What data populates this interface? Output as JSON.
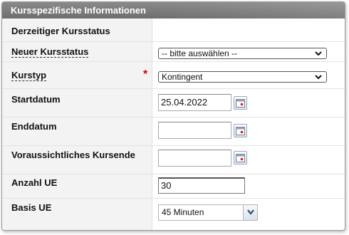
{
  "section": {
    "title": "Kursspezifische Informationen"
  },
  "fields": {
    "current_status": {
      "label": "Derzeitiger Kursstatus",
      "value": ""
    },
    "new_status": {
      "label": "Neuer Kursstatus",
      "selected": "-- bitte auswählen --"
    },
    "course_type": {
      "label": "Kurstyp",
      "required_marker": "*",
      "selected": "Kontingent"
    },
    "start_date": {
      "label": "Startdatum",
      "value": "25.04.2022"
    },
    "end_date": {
      "label": "Enddatum",
      "value": ""
    },
    "expected_end": {
      "label": "Voraussichtliches Kursende",
      "value": ""
    },
    "units_count": {
      "label": "Anzahl UE",
      "value": "30"
    },
    "units_basis": {
      "label": "Basis UE",
      "selected": "45 Minuten"
    }
  },
  "icons": {
    "calendar": "calendar-icon",
    "dropdown": "chevron-down-icon"
  },
  "colors": {
    "header_bg": "#7a7a7a",
    "required": "#d40000",
    "label_bg": "#f3f3f3"
  }
}
